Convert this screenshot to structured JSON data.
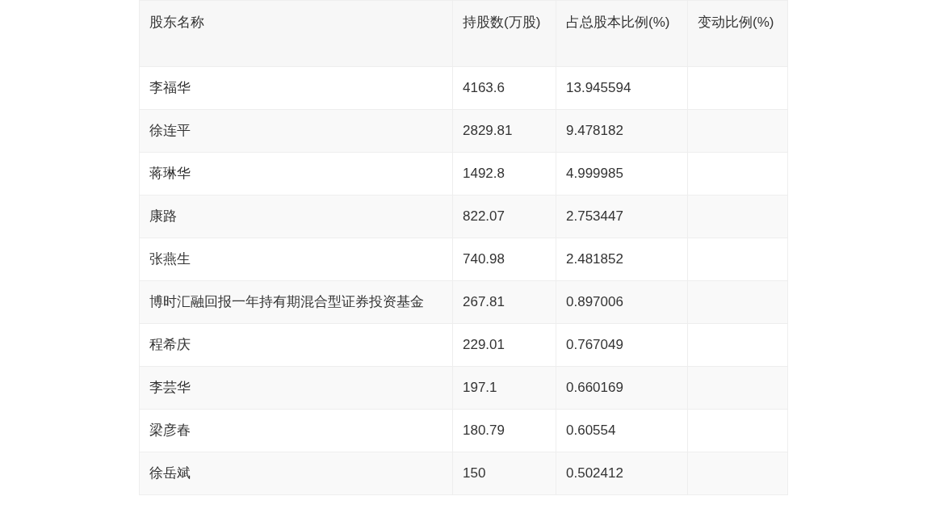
{
  "table": {
    "columns": [
      "股东名称",
      "持股数(万股)",
      "占总股本比例(%)",
      "变动比例(%)"
    ],
    "rows": [
      {
        "name": "李福华",
        "shares": "4163.6",
        "ratio": "13.945594"
      },
      {
        "name": "徐连平",
        "shares": "2829.81",
        "ratio": "9.478182"
      },
      {
        "name": "蒋琳华",
        "shares": "1492.8",
        "ratio": "4.999985"
      },
      {
        "name": "康路",
        "shares": "822.07",
        "ratio": "2.753447"
      },
      {
        "name": "张燕生",
        "shares": "740.98",
        "ratio": "2.481852"
      },
      {
        "name": "博时汇融回报一年持有期混合型证券投资基金",
        "shares": "267.81",
        "ratio": "0.897006"
      },
      {
        "name": "程希庆",
        "shares": "229.01",
        "ratio": "0.767049"
      },
      {
        "name": "李芸华",
        "shares": "197.1",
        "ratio": "0.660169"
      },
      {
        "name": "梁彦春",
        "shares": "180.79",
        "ratio": "0.60554"
      },
      {
        "name": "徐岳斌",
        "shares": "150",
        "ratio": "0.502412"
      }
    ]
  }
}
